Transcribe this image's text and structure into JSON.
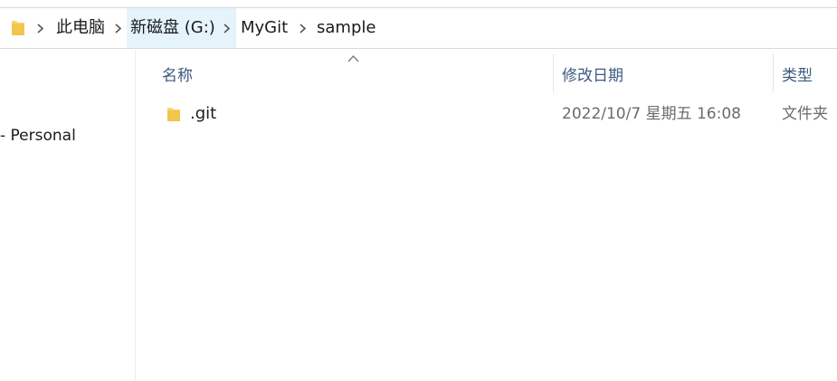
{
  "breadcrumb": {
    "items": [
      {
        "label": "此电脑"
      },
      {
        "label": "新磁盘 (G:)"
      },
      {
        "label": "MyGit"
      },
      {
        "label": "sample"
      }
    ]
  },
  "nav": {
    "items": [
      {
        "label": "- Personal"
      }
    ]
  },
  "columns": {
    "name": "名称",
    "date": "修改日期",
    "type": "类型"
  },
  "files": [
    {
      "name": ".git",
      "date": "2022/10/7 星期五 16:08",
      "type": "文件夹",
      "icon": "folder-icon"
    }
  ],
  "colors": {
    "header_text": "#3d5a80",
    "highlight": "#e5f3fb",
    "folder": "#f8d775"
  }
}
